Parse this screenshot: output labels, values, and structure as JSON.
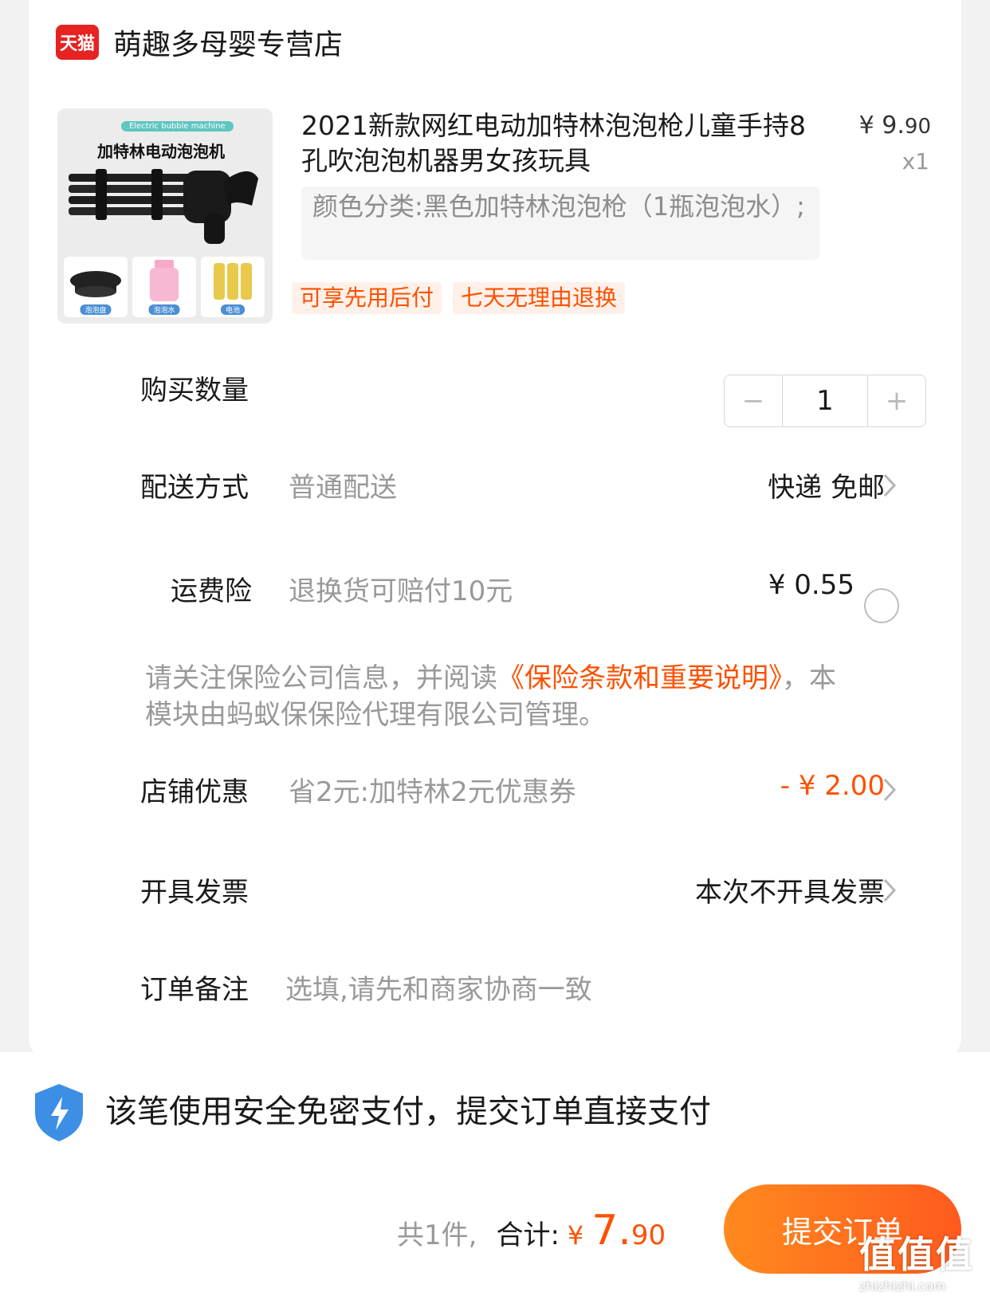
{
  "shop": {
    "badge": "天猫",
    "name": "萌趣多母婴专营店"
  },
  "product": {
    "image_tag_en": "Electric bubble machine",
    "image_tag_cn": "加特林电动泡泡机",
    "image_accessories": [
      "泡泡盘",
      "泡泡水",
      "电池"
    ],
    "title": "2021新款网红电动加特林泡泡枪儿童手持8孔吹泡泡机器男女孩玩具",
    "price_symbol": "¥",
    "price_int": "9.",
    "price_dec": "90",
    "quantity_label": "x1",
    "spec": "颜色分类:黑色加特林泡泡枪（1瓶泡泡水）;",
    "tags": [
      "可享先用后付",
      "七天无理由退换"
    ]
  },
  "quantity": {
    "label": "购买数量",
    "value": "1",
    "minus": "−",
    "plus": "+"
  },
  "delivery": {
    "label": "配送方式",
    "sub": "普通配送",
    "value": "快递 免邮"
  },
  "insurance": {
    "label": "运费险",
    "sub": "退换货可赔付10元",
    "value": "¥ 0.55",
    "notice_pre": "请关注保险公司信息，并阅读",
    "notice_link": "《保险条款和重要说明》",
    "notice_post": "，本模块由蚂蚁保保险代理有限公司管理。"
  },
  "discount": {
    "label": "店铺优惠",
    "sub": "省2元:加特林2元优惠券",
    "value": "- ¥ 2.00"
  },
  "invoice": {
    "label": "开具发票",
    "value": "本次不开具发票"
  },
  "remark": {
    "label": "订单备注",
    "placeholder": "选填,请先和商家协商一致"
  },
  "footer": {
    "secure_text": "该笔使用安全免密支付，提交订单直接支付",
    "count_text": "共1件,",
    "total_label": "合计:",
    "yen": "¥",
    "total_int": "7.",
    "total_dec": "90",
    "submit_label": "提交订单"
  },
  "watermark": {
    "glyphs": "值值值",
    "url": "zhizhizhi.com"
  },
  "colors": {
    "accent": "#ff5000",
    "tmall_red": "#e62222",
    "shield_blue": "#3d8fe6"
  }
}
